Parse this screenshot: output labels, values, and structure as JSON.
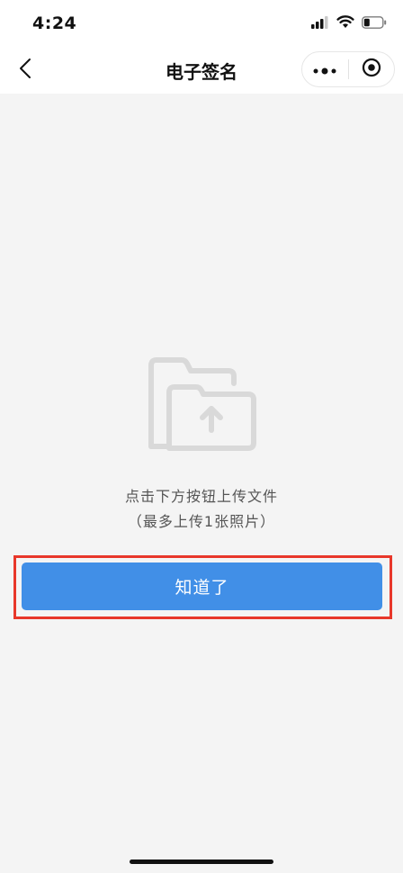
{
  "status_bar": {
    "time": "4:24",
    "icons": [
      "signal-icon",
      "wifi-icon",
      "battery-icon"
    ]
  },
  "nav": {
    "title": "电子签名",
    "back_icon": "chevron-left-icon",
    "more_icon": "more-dots-icon",
    "close_icon": "target-close-icon"
  },
  "content": {
    "folder_icon": "folder-upload-icon",
    "hint_line1": "点击下方按钮上传文件",
    "hint_line2": "（最多上传1张照片）",
    "button_label": "知道了"
  },
  "colors": {
    "primary": "#418fe7",
    "highlight": "#e8372a",
    "background": "#f4f4f4",
    "icon_gray": "#d9d9d9"
  }
}
